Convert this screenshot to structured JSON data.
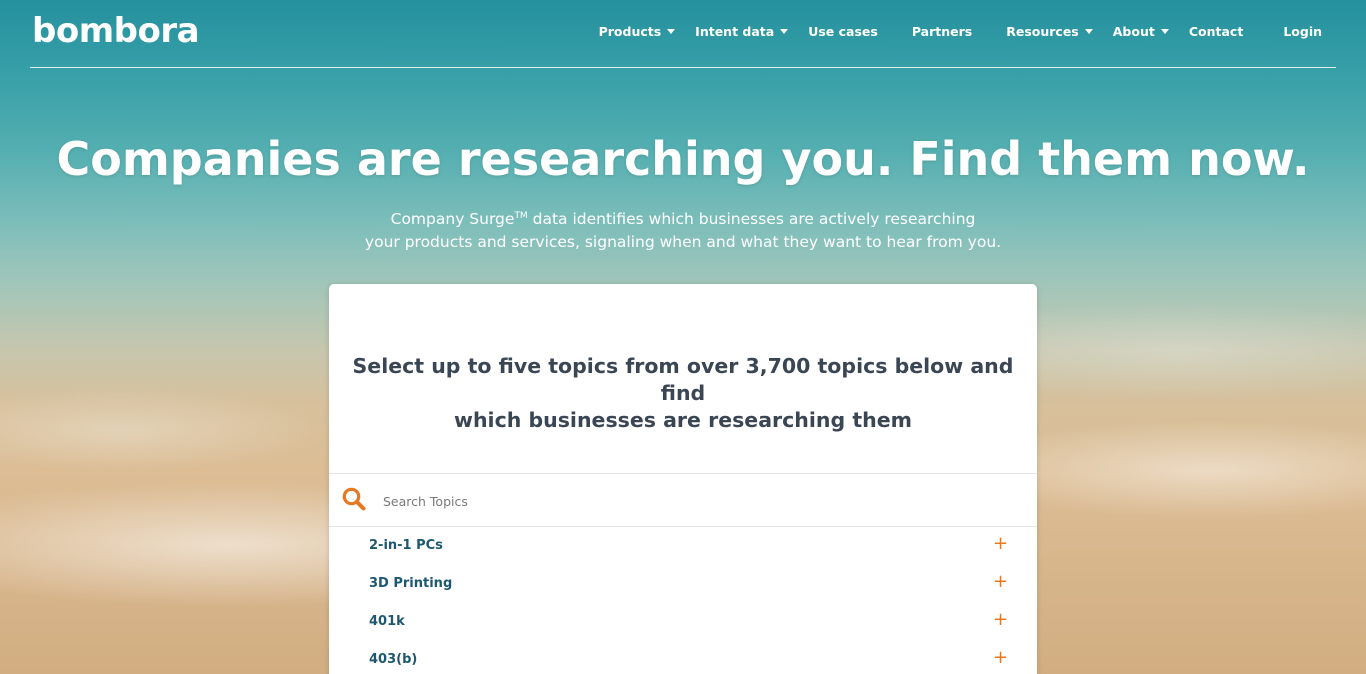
{
  "brand": {
    "logo": "bombora"
  },
  "nav": {
    "items": [
      {
        "label": "Products",
        "dropdown": true
      },
      {
        "label": "Intent data",
        "dropdown": true
      },
      {
        "label": "Use cases",
        "dropdown": false
      },
      {
        "label": "Partners",
        "dropdown": false
      },
      {
        "label": "Resources",
        "dropdown": true
      },
      {
        "label": "About",
        "dropdown": true
      },
      {
        "label": "Contact",
        "dropdown": false
      },
      {
        "label": "Login",
        "dropdown": false
      }
    ]
  },
  "hero": {
    "title": "Companies are researching you. Find them now.",
    "subtitle_brand": "Company Surge",
    "subtitle_tm": "TM",
    "subtitle_line1_rest": " data identifies which businesses are actively researching",
    "subtitle_line2": "your products and services, signaling when and what they want to hear from you."
  },
  "topics_card": {
    "heading_line1": "Select up to five topics from over 3,700 topics below and find",
    "heading_line2": "which businesses are researching them",
    "search": {
      "placeholder": "Search Topics",
      "value": "",
      "icon": "search-icon"
    },
    "topics": [
      {
        "label": "2-in-1 PCs",
        "action": "+"
      },
      {
        "label": "3D Printing",
        "action": "+"
      },
      {
        "label": "401k",
        "action": "+"
      },
      {
        "label": "403(b)",
        "action": "+"
      }
    ]
  },
  "colors": {
    "accent_orange": "#e87722",
    "topic_text": "#1d5771",
    "heading_text": "#3b4654",
    "white": "#ffffff"
  }
}
